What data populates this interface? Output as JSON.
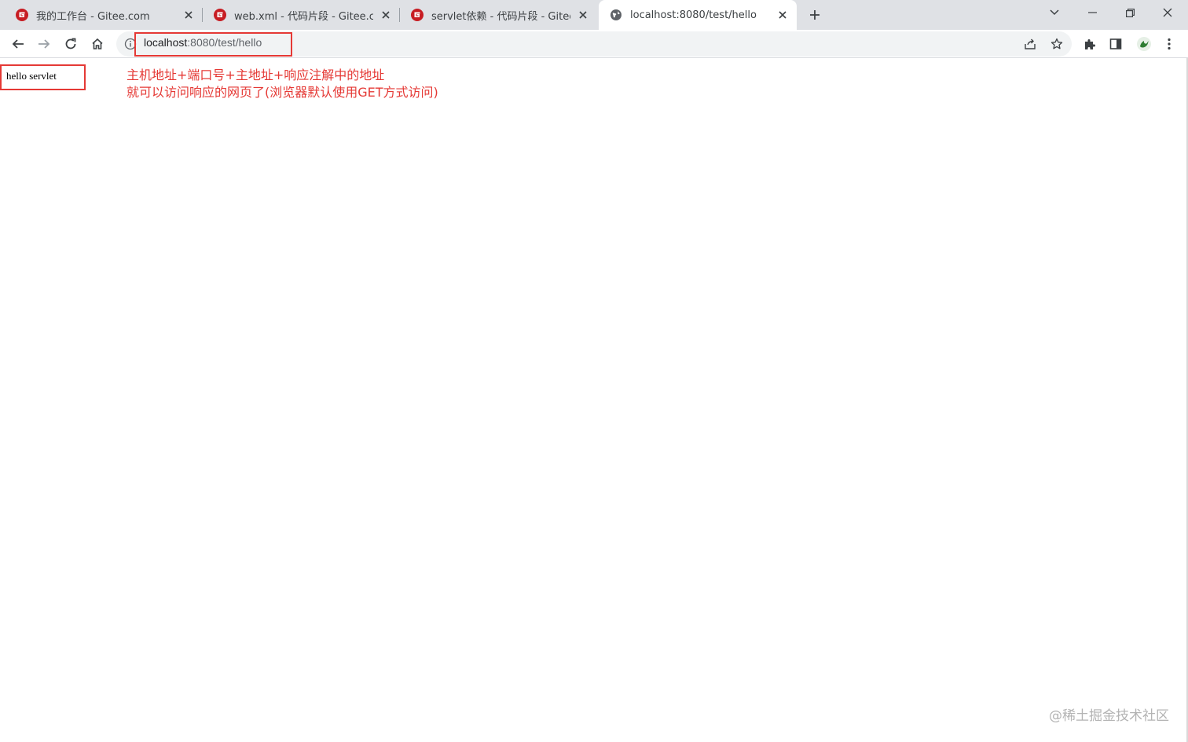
{
  "tabs": [
    {
      "title": "我的工作台 - Gitee.com",
      "favicon": "gitee-icon"
    },
    {
      "title": "web.xml - 代码片段 - Gitee.com",
      "favicon": "gitee-icon"
    },
    {
      "title": "servlet依赖 - 代码片段 - Gitee.com",
      "favicon": "gitee-icon"
    },
    {
      "title": "localhost:8080/test/hello",
      "favicon": "globe-icon",
      "active": true
    }
  ],
  "address_bar": {
    "host": "localhost",
    "path": ":8080/test/hello"
  },
  "page": {
    "body_text": "hello servlet"
  },
  "annotation": {
    "line1": "主机地址+端口号+主地址+响应注解中的地址",
    "line2": "就可以访问响应的网页了(浏览器默认使用GET方式访问)"
  },
  "watermark": "@稀土掘金技术社区",
  "colors": {
    "tabstrip": "#dfe1e5",
    "annotation_red": "#e53935",
    "gitee_red": "#c71d23"
  }
}
